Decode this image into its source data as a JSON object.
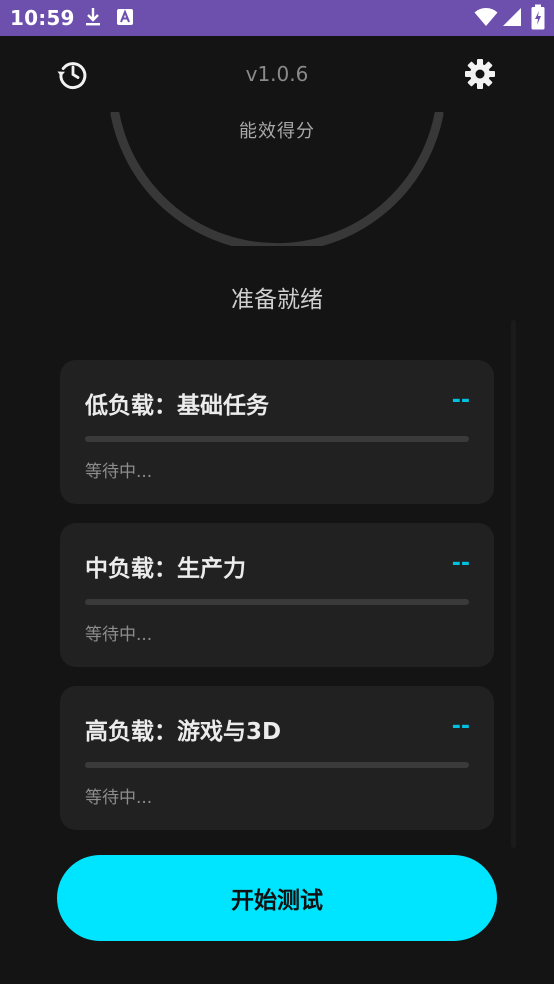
{
  "status_bar": {
    "time": "10:59",
    "icons": [
      "download-icon",
      "a-badge-icon",
      "wifi-icon",
      "signal-icon",
      "battery-charging-icon"
    ],
    "background": "#6d4fad"
  },
  "header": {
    "version": "v1.0.6",
    "left_icon": "history-icon",
    "right_icon": "settings-icon"
  },
  "gauge": {
    "label": "能效得分"
  },
  "status_text": "准备就绪",
  "cards": [
    {
      "title": "低负载：基础任务",
      "score": "--",
      "state": "等待中...",
      "progress": 0
    },
    {
      "title": "中负载：生产力",
      "score": "--",
      "state": "等待中...",
      "progress": 0
    },
    {
      "title": "高负载：游戏与3D",
      "score": "--",
      "state": "等待中...",
      "progress": 0
    }
  ],
  "start_button": {
    "label": "开始测试"
  },
  "colors": {
    "background": "#141414",
    "card": "#212121",
    "accent": "#00e5ff",
    "score": "#00c2e0",
    "gauge_track": "#383838"
  }
}
